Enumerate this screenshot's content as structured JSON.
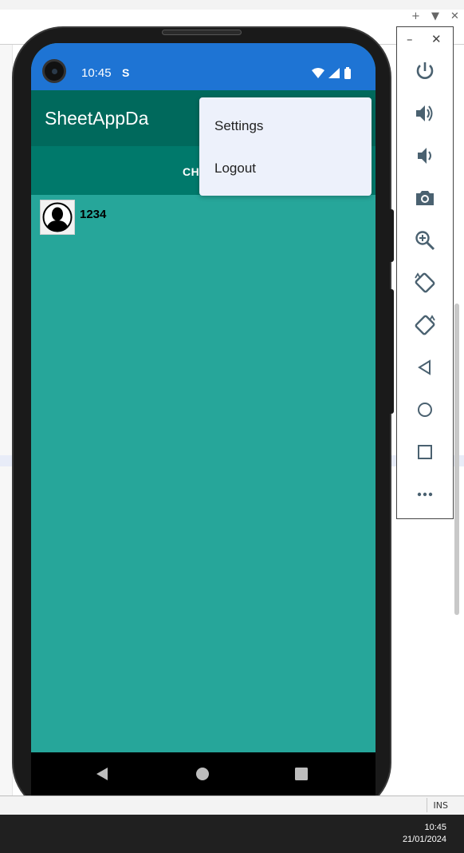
{
  "ide": {
    "add_label": "+",
    "dropdown_label": "▼",
    "close_label": "✕",
    "status_mode": "INS",
    "taskbar_time": "10:45",
    "taskbar_date": "21/01/2024"
  },
  "emulator_panel": {
    "minimize_label": "–",
    "close_label": "✕",
    "buttons": [
      "power-icon",
      "volume-up-icon",
      "volume-down-icon",
      "camera-icon",
      "zoom-icon",
      "rotate-left-icon",
      "rotate-right-icon",
      "back-icon",
      "home-icon",
      "overview-icon",
      "more-icon"
    ]
  },
  "device": {
    "status_time": "10:45",
    "status_s_icon": "S",
    "colors": {
      "status_bar": "#1e74d4",
      "app_bar": "#00695c",
      "tab_bar": "#00796b",
      "content": "#26a69a",
      "menu": "#edf1fb"
    }
  },
  "app": {
    "title": "SheetAppDa",
    "tab_label": "CH",
    "contacts": [
      {
        "name": "1234",
        "avatar": "person-silhouette-icon"
      }
    ]
  },
  "overflow_menu": {
    "items": [
      "Settings",
      "Logout"
    ]
  }
}
